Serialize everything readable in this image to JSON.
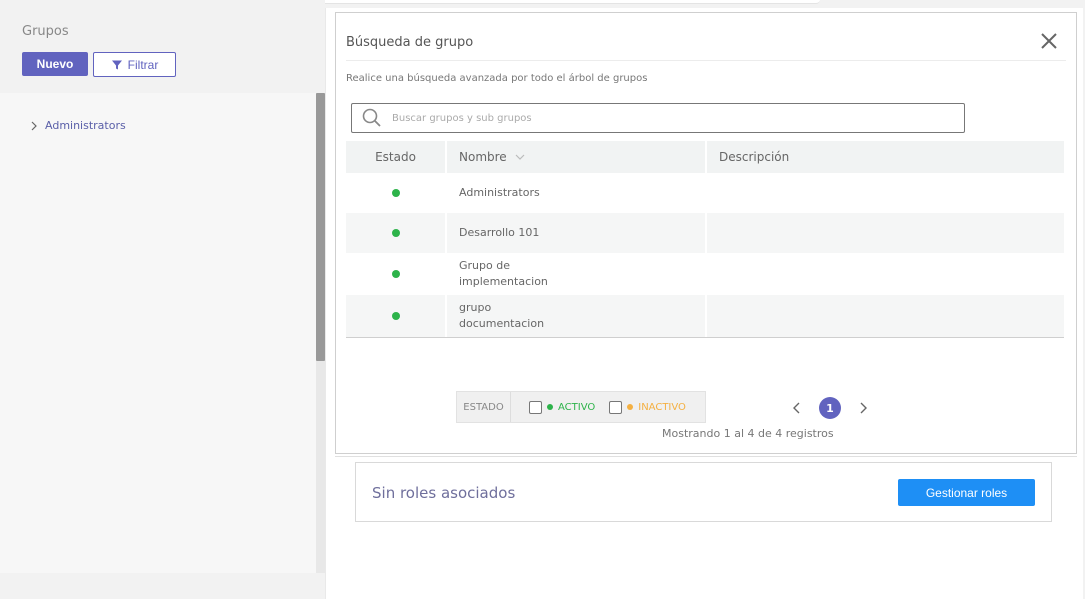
{
  "sidebar": {
    "title": "Grupos",
    "new_label": "Nuevo",
    "filter_label": "Filtrar",
    "tree_items": [
      {
        "label": "Administrators"
      }
    ]
  },
  "modal": {
    "title": "Búsqueda de grupo",
    "subtitle": "Realice una búsqueda avanzada por todo el árbol de grupos",
    "search_placeholder": "Buscar grupos y sub grupos",
    "columns": {
      "estado": "Estado",
      "nombre": "Nombre",
      "descripcion": "Descripción"
    },
    "rows": [
      {
        "nombre": "Administrators",
        "descripcion": "",
        "status": "active"
      },
      {
        "nombre": "Desarrollo 101",
        "descripcion": "",
        "status": "active"
      },
      {
        "nombre": "Grupo de implementacion",
        "descripcion": "",
        "status": "active"
      },
      {
        "nombre": "grupo documentacion",
        "descripcion": "",
        "status": "active"
      }
    ],
    "filter": {
      "label": "ESTADO",
      "active": "ACTIVO",
      "inactive": "INACTIVO"
    },
    "pagination": {
      "current_page": "1",
      "records": "Mostrando 1 al 4 de 4 registros"
    }
  },
  "roles": {
    "empty_text": "Sin roles asociados",
    "manage_label": "Gestionar roles"
  },
  "colors": {
    "primary": "#6163bf",
    "active": "#2db34a",
    "inactive": "#f4b042",
    "button_blue": "#1e8ff5"
  },
  "icons": [
    "funnel-icon",
    "chevron-right-icon",
    "close-icon",
    "search-icon",
    "sort-chevron-icon",
    "chevron-left-icon"
  ]
}
